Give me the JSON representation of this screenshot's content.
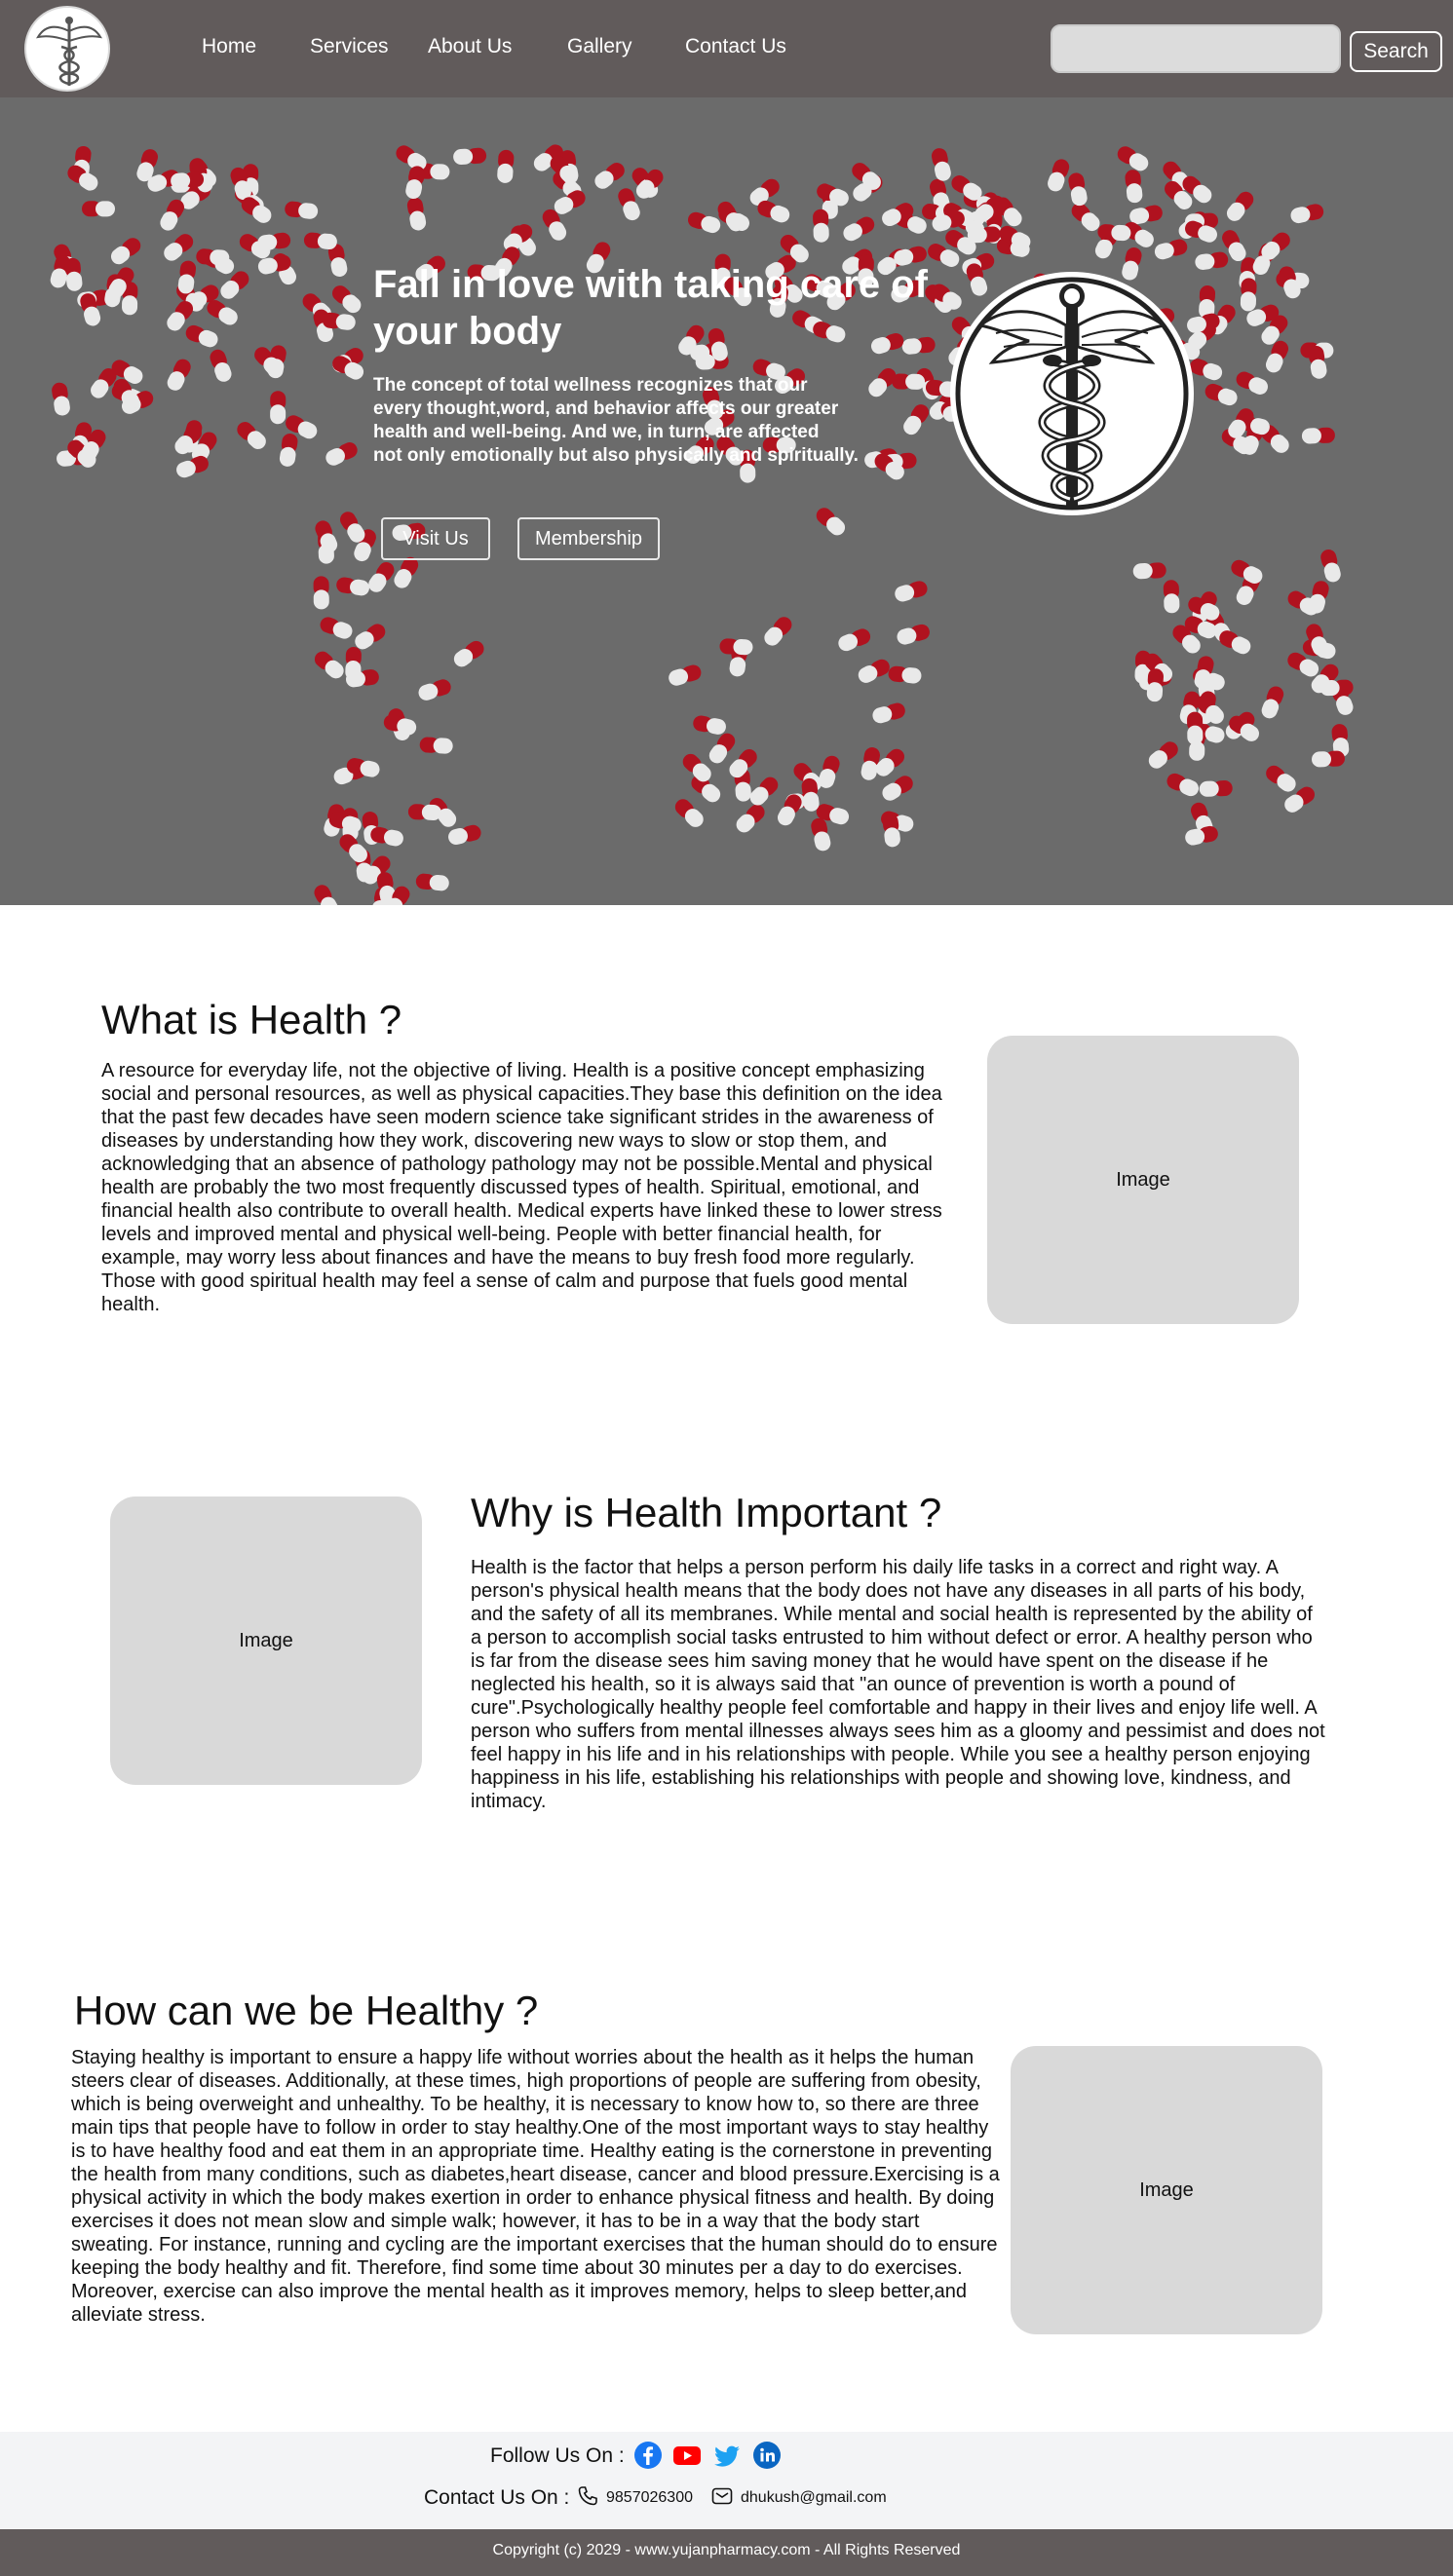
{
  "nav": {
    "links": [
      "Home",
      "Services",
      "About Us",
      "Gallery",
      "Contact Us"
    ],
    "search_placeholder": "",
    "search_button": "Search"
  },
  "hero": {
    "title": "Fall in love with taking care of your body",
    "text": " The concept of total wellness recognizes that our\nevery thought,word, and behavior affects our greater\nhealth and well-being. And we, in turn, are affected\nnot only emotionally but also physically and spiritually.",
    "buttons": [
      "Visit Us",
      "Membership"
    ]
  },
  "sections": [
    {
      "title": "What is Health ?",
      "text": "A resource for everyday life, not the objective of living. Health is a positive concept emphasizing social and personal resources, as well as physical capacities.They base this definition on the idea that the past few decades have seen modern science take significant strides in the awareness of diseases by understanding how they work, discovering new ways to slow or stop them, and acknowledging that an absence of pathology pathology may not be possible.Mental and physical health are probably the two most frequently discussed types of health. Spiritual, emotional, and financial health also contribute to overall health. Medical experts have linked these to lower stress levels and improved mental and physical well-being. People with better financial health, for example, may worry less about finances and have the means to buy fresh food more regularly. Those with good spiritual health may feel a sense of calm and purpose that fuels good mental health.",
      "image_label": "Image"
    },
    {
      "title": "Why is Health Important ?",
      "text": "Health is the factor that helps a person perform his daily life tasks in a correct and right way. A person's physical health means that the body does not have any diseases in all parts of his body, and the safety of all its membranes. While mental and social health is represented by the ability of a person to accomplish social tasks entrusted to him without defect or error. A healthy person who is far from the disease sees him saving money that he would have spent on the disease if he neglected his health, so it is always said that \"an ounce of prevention is worth a pound of cure\".Psychologically healthy people feel comfortable and happy in their lives and enjoy life well. A person who suffers from mental illnesses always sees him as a gloomy and pessimist and does not feel happy in his life and in his relationships with people. While you see a healthy person enjoying happiness in his life, establishing his relationships with people and showing love, kindness, and intimacy.",
      "image_label": "Image"
    },
    {
      "title": "How can we be Healthy ?",
      "text": "Staying healthy is important to ensure a happy life without worries about the health as it helps the human steers clear of diseases. Additionally, at these times, high proportions of people are suffering from obesity, which is being overweight and unhealthy. To be healthy, it is necessary to know how to, so there are three main tips that people have to follow in order to stay healthy.One of the most important ways to stay healthy is to have healthy food and eat them in an appropriate time. Healthy eating is the cornerstone in preventing the health from many conditions, such as diabetes,heart disease, cancer and blood pressure.Exercising is a physical activity in which the body makes exertion in order to enhance physical fitness and health. By doing exercises it does not mean slow and simple walk; however, it has to be in a way that the body start sweating. For instance, running and cycling are the important exercises that the human should do to ensure keeping the body healthy and fit. Therefore, find some time about 30 minutes per a day to do exercises. Moreover, exercise can also improve the mental health as it improves memory, helps to sleep better,and alleviate stress.",
      "image_label": "Image"
    }
  ],
  "footer": {
    "follow_label": "Follow Us On :",
    "social_icons": [
      "facebook-icon",
      "youtube-icon",
      "twitter-icon",
      "linkedin-icon"
    ],
    "contact_label": "Contact Us On :",
    "phone": "9857026300",
    "email": "dhukush@gmail.com",
    "copyright": "Copyright (c) 2029  -  www.yujanpharmacy.com - All Rights Reserved"
  },
  "colors": {
    "nav_bg": "#615b5b",
    "hero_bg": "#6b6b6b",
    "pill_red": "#b0121f",
    "image_placeholder": "#d9d9d9",
    "footer_bg": "#f3f4f6",
    "facebook": "#1877f2",
    "youtube": "#ff0000",
    "twitter": "#1da1f2",
    "linkedin": "#0a66c2"
  }
}
